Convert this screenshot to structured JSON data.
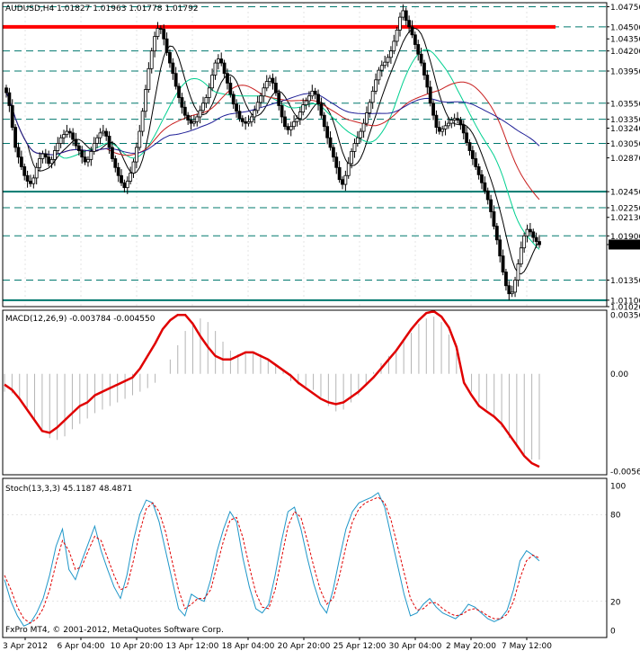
{
  "watermark": "FxPro MT4, © 2001-2012, MetaQuotes Software Corp.",
  "colors": {
    "background": "#ffffff",
    "grid": "#c8c8c8",
    "border": "#000000",
    "candle": "#000000",
    "level_line": "#00786e",
    "resistance": "#ff0000",
    "ma_fast": "#000000",
    "ma_mid": "#00d090",
    "ma_slow1": "#c81e1e",
    "ma_slow2": "#1e1e96",
    "macd_line": "#e00000",
    "macd_hist": "#b4b4b4",
    "stoch_main": "#1e96c8",
    "stoch_signal": "#e00000",
    "current_price_bg": "#000000",
    "current_price_fg": "#ffffff"
  },
  "chart_data": [
    {
      "type": "candlestick",
      "title": "AUDUSD,H4  1.01827 1.01963 1.01778 1.01792",
      "ylim": [
        1.0102,
        1.048
      ],
      "grid": true,
      "x_ticks": [
        "3 Apr 2012",
        "6 Apr 04:00",
        "10 Apr 20:00",
        "13 Apr 12:00",
        "18 Apr 04:00",
        "20 Apr 20:00",
        "25 Apr 12:00",
        "30 Apr 04:00",
        "2 May 20:00",
        "7 May 12:00"
      ],
      "y_ticks": [
        "1.04750",
        "1.04500",
        "1.04350",
        "1.04200",
        "1.03950",
        "1.03550",
        "1.03350",
        "1.03240",
        "1.03050",
        "1.02870",
        "1.02450",
        "1.02250",
        "1.02130",
        "1.01900",
        "1.01792",
        "1.01350",
        "1.01100",
        "1.01020"
      ],
      "current_price": "1.01792",
      "horizontal_levels": [
        1.0475,
        1.045,
        1.042,
        1.0395,
        1.0355,
        1.0335,
        1.0305,
        1.0245,
        1.0225,
        1.019,
        1.0135,
        1.011
      ],
      "solid_levels": [
        1.0245,
        1.011
      ],
      "resistance_level": 1.045,
      "candles_close": [
        1.0368,
        1.0352,
        1.0325,
        1.03,
        1.0288,
        1.0276,
        1.0265,
        1.0258,
        1.0255,
        1.0262,
        1.0275,
        1.0286,
        1.0292,
        1.0288,
        1.028,
        1.0285,
        1.0296,
        1.0305,
        1.0312,
        1.0316,
        1.032,
        1.0318,
        1.031,
        1.0302,
        1.0296,
        1.0288,
        1.0282,
        1.0285,
        1.0295,
        1.0305,
        1.0312,
        1.0318,
        1.032,
        1.0314,
        1.03,
        1.0286,
        1.0275,
        1.0265,
        1.0256,
        1.025,
        1.0258,
        1.0268,
        1.0282,
        1.03,
        1.032,
        1.0345,
        1.0372,
        1.0398,
        1.042,
        1.0438,
        1.0448,
        1.0447,
        1.0435,
        1.0418,
        1.0405,
        1.0392,
        1.0376,
        1.0362,
        1.035,
        1.034,
        1.0334,
        1.033,
        1.0332,
        1.0338,
        1.0346,
        1.0355,
        1.0362,
        1.0374,
        1.039,
        1.0405,
        1.041,
        1.0405,
        1.0392,
        1.038,
        1.0366,
        1.0354,
        1.0345,
        1.0336,
        1.0332,
        1.033,
        1.0332,
        1.0338,
        1.0346,
        1.0356,
        1.0364,
        1.0374,
        1.0382,
        1.0386,
        1.038,
        1.0368,
        1.0352,
        1.0338,
        1.0326,
        1.0322,
        1.0326,
        1.0332,
        1.0336,
        1.0344,
        1.0353,
        1.0358,
        1.0364,
        1.037,
        1.0366,
        1.0354,
        1.034,
        1.0326,
        1.0312,
        1.03,
        1.0288,
        1.0275,
        1.026,
        1.0254,
        1.0265,
        1.028,
        1.0295,
        1.0305,
        1.0312,
        1.032,
        1.033,
        1.0343,
        1.0356,
        1.037,
        1.0384,
        1.0396,
        1.0402,
        1.0406,
        1.0412,
        1.042,
        1.0432,
        1.0446,
        1.0462,
        1.047,
        1.0458,
        1.045,
        1.044,
        1.0428,
        1.0416,
        1.0405,
        1.039,
        1.0375,
        1.0355,
        1.034,
        1.0325,
        1.032,
        1.0323,
        1.0327,
        1.033,
        1.0334,
        1.0336,
        1.0334,
        1.0328,
        1.0318,
        1.0306,
        1.0296,
        1.0286,
        1.0276,
        1.0266,
        1.0256,
        1.0246,
        1.0235,
        1.022,
        1.0202,
        1.0185,
        1.0165,
        1.0145,
        1.0128,
        1.0118,
        1.012,
        1.0135,
        1.0155,
        1.0175,
        1.019,
        1.0198,
        1.0195,
        1.0188,
        1.0183,
        1.0179
      ]
    },
    {
      "type": "line",
      "title": "MACD(12,26,9) -0.003784 -0.004550",
      "ylim": [
        -0.00565,
        0.00356
      ],
      "y_ticks": [
        "0.00356",
        "0.00",
        "-0.00565"
      ],
      "series": [
        {
          "values": [
            -0.001,
            -0.0011,
            -0.0014,
            -0.0019,
            -0.0026,
            -0.0032,
            -0.0036,
            -0.0037,
            -0.0035,
            -0.0031,
            -0.0028,
            -0.0025,
            -0.0022,
            -0.002,
            -0.0018,
            -0.0016,
            -0.0014,
            -0.0012,
            -0.001,
            -0.0008,
            -0.0005,
            0.0,
            0.0008,
            0.0016,
            0.0024,
            0.0029,
            0.0031,
            0.0029,
            0.0024,
            0.0018,
            0.0013,
            0.0011,
            0.0012,
            0.0012,
            0.0011,
            0.0008,
            0.0005,
            0.0002,
            -0.0004,
            -0.0006,
            -0.0007,
            -0.0009,
            -0.0013,
            -0.0018,
            -0.0021,
            -0.002,
            -0.0016,
            -0.0012,
            -0.0006,
            0.0001,
            0.0006,
            0.001,
            0.0013,
            0.0018,
            0.0023,
            0.0028,
            0.0031,
            0.0032,
            0.0029,
            0.0022,
            0.0012,
            0.0,
            -0.001,
            -0.0016,
            -0.002,
            -0.0024,
            -0.003,
            -0.0036,
            -0.0041,
            -0.0045,
            -0.0048,
            -0.0048
          ]
        },
        {
          "values": [
            -0.0006,
            -0.0009,
            -0.0014,
            -0.002,
            -0.0026,
            -0.0032,
            -0.0033,
            -0.003,
            -0.0026,
            -0.0022,
            -0.0018,
            -0.0016,
            -0.0012,
            -0.001,
            -0.0008,
            -0.0006,
            -0.0004,
            -0.0002,
            0.0003,
            0.001,
            0.0017,
            0.0025,
            0.003,
            0.0033,
            0.0033,
            0.0028,
            0.0021,
            0.0015,
            0.001,
            0.0008,
            0.0008,
            0.001,
            0.0012,
            0.0012,
            0.001,
            0.0008,
            0.0005,
            0.0002,
            -0.0001,
            -0.0005,
            -0.0008,
            -0.0011,
            -0.0014,
            -0.0016,
            -0.0017,
            -0.0016,
            -0.0013,
            -0.001,
            -0.0006,
            -0.0002,
            0.0003,
            0.0008,
            0.0013,
            0.0019,
            0.0025,
            0.003,
            0.0034,
            0.0035,
            0.0032,
            0.0026,
            0.0015,
            -0.0005,
            -0.0012,
            -0.0018,
            -0.0021,
            -0.0024,
            -0.0028,
            -0.0034,
            -0.004,
            -0.0046,
            -0.005,
            -0.0052
          ]
        }
      ]
    },
    {
      "type": "line",
      "title": "Stoch(13,3,3) 45.1187 48.4871",
      "ylim": [
        0,
        100
      ],
      "y_ticks": [
        "100",
        "80",
        "20",
        "0"
      ],
      "series": [
        {
          "values": [
            35,
            20,
            10,
            3,
            5,
            12,
            22,
            38,
            58,
            70,
            42,
            35,
            48,
            60,
            72,
            55,
            42,
            30,
            22,
            38,
            62,
            80,
            90,
            88,
            75,
            55,
            35,
            15,
            10,
            25,
            22,
            20,
            35,
            55,
            70,
            82,
            75,
            50,
            30,
            15,
            12,
            18,
            38,
            62,
            82,
            85,
            70,
            50,
            32,
            18,
            12,
            28,
            50,
            70,
            82,
            88,
            90,
            92,
            95,
            85,
            65,
            45,
            25,
            10,
            12,
            18,
            22,
            16,
            12,
            10,
            8,
            12,
            18,
            16,
            12,
            8,
            6,
            8,
            14,
            28,
            48,
            55,
            52,
            48
          ]
        },
        {
          "values": [
            38,
            28,
            16,
            8,
            5,
            8,
            15,
            28,
            46,
            62,
            55,
            42,
            44,
            55,
            65,
            62,
            50,
            38,
            28,
            30,
            48,
            68,
            84,
            88,
            82,
            68,
            48,
            28,
            15,
            18,
            22,
            22,
            28,
            45,
            62,
            76,
            78,
            64,
            44,
            26,
            16,
            15,
            28,
            50,
            72,
            82,
            78,
            62,
            44,
            28,
            18,
            22,
            38,
            58,
            75,
            84,
            88,
            90,
            92,
            88,
            76,
            58,
            40,
            22,
            14,
            15,
            19,
            19,
            15,
            12,
            10,
            11,
            14,
            15,
            13,
            10,
            8,
            8,
            11,
            20,
            36,
            48,
            52,
            50
          ]
        }
      ]
    }
  ]
}
